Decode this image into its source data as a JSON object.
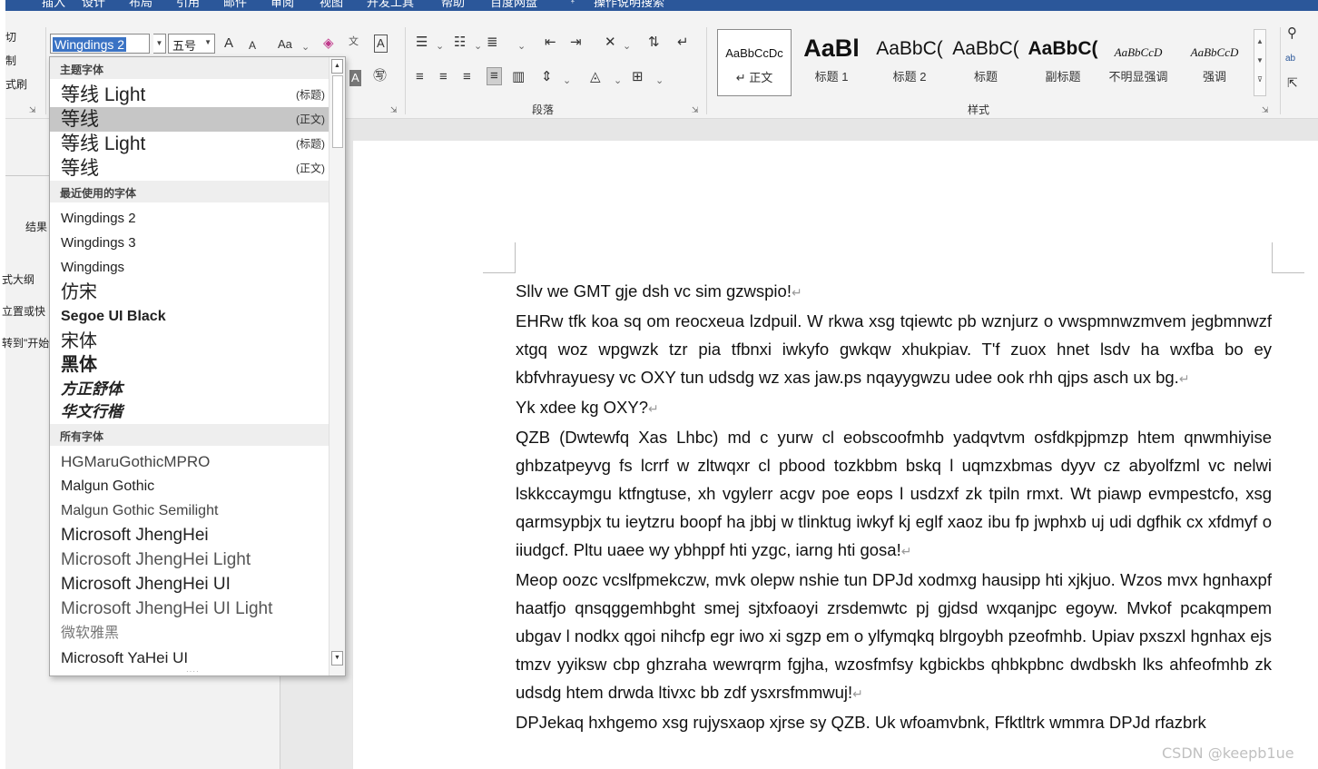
{
  "ribbon_tabs": [
    "插入",
    "设计",
    "布局",
    "引用",
    "邮件",
    "审阅",
    "视图",
    "开发工具",
    "帮助",
    "百度网盘",
    "操作说明搜索"
  ],
  "clipboard": {
    "items": [
      "切",
      "制",
      "式刷"
    ]
  },
  "font": {
    "name": "Wingdings 2",
    "size": "五号",
    "grow": "A",
    "shrink": "A",
    "case_label": "Aa"
  },
  "paragraph": {
    "label": "段落"
  },
  "styles": {
    "label": "样式",
    "items": [
      {
        "sample": "AaBbCcDc",
        "name": "↵ 正文"
      },
      {
        "sample": "AaBl",
        "name": "标题 1"
      },
      {
        "sample": "AaBbC(",
        "name": "标题 2"
      },
      {
        "sample": "AaBbC(",
        "name": "标题"
      },
      {
        "sample": "AaBbC(",
        "name": "副标题"
      },
      {
        "sample": "AaBbCcD",
        "name": "不明显强调"
      },
      {
        "sample": "AaBbCcD",
        "name": "强调"
      }
    ]
  },
  "left_pane": {
    "result": "结果",
    "items": [
      "式大纲",
      "立置或快",
      "转到\"开始"
    ]
  },
  "font_list": {
    "sections": {
      "theme": "主题字体",
      "recent": "最近使用的字体",
      "all": "所有字体"
    },
    "theme_fonts": [
      {
        "name": "等线 Light",
        "tag": "(标题)"
      },
      {
        "name": "等线",
        "tag": "(正文)",
        "selected": true
      },
      {
        "name": "等线 Light",
        "tag": "(标题)"
      },
      {
        "name": "等线",
        "tag": "(正文)"
      }
    ],
    "recent_fonts": [
      "Wingdings 2",
      "Wingdings 3",
      "Wingdings",
      "仿宋",
      "Segoe UI Black",
      "宋体",
      "黑体",
      "方正舒体",
      "华文行楷"
    ],
    "all_fonts": [
      "HGMaruGothicMPRO",
      "Malgun Gothic",
      "Malgun Gothic Semilight",
      "Microsoft JhengHei",
      "Microsoft JhengHei Light",
      "Microsoft JhengHei UI",
      "Microsoft JhengHei UI Light",
      "微软雅黑",
      "Microsoft YaHei UI"
    ]
  },
  "document": {
    "paragraphs": [
      "Sllv we GMT gje dsh vc sim gzwspio!",
      "EHRw tfk koa sq om reocxeua lzdpuil. W rkwa xsg tqiewtc pb wznjurz o vwspmnwzmvem jegbmnwzf xtgq woz wpgwzk tzr pia tfbnxi iwkyfo gwkqw xhukpiav. T'f zuox hnet lsdv ha wxfba bo ey kbfvhrayuesy vc OXY tun udsdg wz xas jaw.ps nqayygwzu udee ook rhh qjps asch ux bg.",
      "Yk xdee kg OXY?",
      "QZB (Dwtewfq Xas Lhbc) md c yurw cl eobscoofmhb yadqvtvm osfdkpjpmzp htem qnwmhiyise ghbzatpeyvg fs lcrrf w zltwqxr cl pbood tozkbbm bskq l uqmzxbmas dyyv cz abyolfzml vc nelwi lskkccaymgu ktfngtuse, xh vgylerr acgv poe eops l usdzxf zk tpiln rmxt. Wt piawp evmpestcfo, xsg qarmsypbjx tu ieytzru boopf ha jbbj w tlinktug iwkyf kj eglf xaoz ibu fp jwphxb uj udi dgfhik cx xfdmyf o iiudgcf. Pltu uaee wy ybhppf hti yzgc, iarng hti gosa!",
      "Meop oozc vcslfpmekczw, mvk olepw nshie tun DPJd xodmxg hausipp hti xjkjuo. Wzos mvx hgnhaxpf haatfjo qnsqggemhbght smej sjtxfoaoyi zrsdemwtc pj gjdsd wxqanjpc egoyw. Mvkof pcakqmpem ubgav l nodkx qgoi nihcfp egr iwo xi sgzp em o ylfymqkq blrgoybh pzeofmhb. Upiav pxszxl hgnhax ejs tmzv yyiksw cbp ghzraha wewrqrm fgjha, wzosfmfsy kgbickbs qhbkpbnc dwdbskh lks ahfeofmhb zk udsdg htem drwda ltivxc bb zdf ysxrsfmmwuj!",
      "DPJekaq hxhgemo xsg rujysxaop xjrse sy QZB. Uk wfoamvbnk, Ffktltrk wmmra DPJd rfazbrk"
    ]
  },
  "watermark": "CSDN @keepb1ue"
}
